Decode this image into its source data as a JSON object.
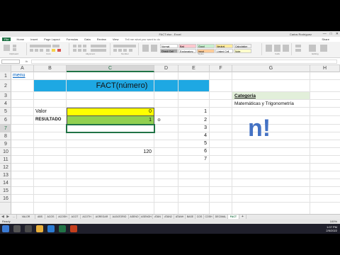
{
  "window": {
    "title": "FACT.xlsx - Excel",
    "account": "Carlos Rodríguez"
  },
  "ribbon_tabs": [
    "File",
    "Home",
    "Insert",
    "Page Layout",
    "Formulas",
    "Data",
    "Review",
    "View"
  ],
  "tell_me": "Tell me what you want to do",
  "share_label": "Share",
  "ribbon_groups": [
    "Clipboard",
    "Font",
    "Alignment",
    "Number",
    "Styles",
    "Cells",
    "Editing"
  ],
  "styles_gallery": [
    {
      "label": "Normal",
      "color": "#ffffff"
    },
    {
      "label": "Bad",
      "color": "#ffc7ce"
    },
    {
      "label": "Good",
      "color": "#c6efce"
    },
    {
      "label": "Neutral",
      "color": "#ffeb9c"
    },
    {
      "label": "Calculation",
      "color": "#f2f2f2"
    },
    {
      "label": "Check Cell",
      "color": "#a5a5a5"
    },
    {
      "label": "Explanatory...",
      "color": "#ffffff"
    },
    {
      "label": "Input",
      "color": "#ffcc99"
    },
    {
      "label": "Linked Cell",
      "color": "#ffffff"
    },
    {
      "label": "Note",
      "color": "#ffffcc"
    }
  ],
  "formula_bar": {
    "name_box": "",
    "fx": "fx",
    "formula": ""
  },
  "columns": [
    "A",
    "B",
    "C",
    "D",
    "E",
    "F",
    "G",
    "H"
  ],
  "rows": [
    "1",
    "2",
    "3",
    "4",
    "5",
    "6",
    "7",
    "8",
    "9",
    "10",
    "11",
    "12",
    "13",
    "14",
    "15",
    "16"
  ],
  "active_cell": {
    "column": "C",
    "row": "7"
  },
  "cells": {
    "menu_link": "menu",
    "header_title": "FACT(número)",
    "category_label": "Categoria",
    "category_value": "Matemáticas y Trigonometría",
    "valor_label": "Valor",
    "valor_value": "0",
    "resultado_label": "RESULTADO",
    "resultado_value": "1",
    "d6_symbol": "⊕",
    "c10_value": "120",
    "big_symbol": "n!",
    "e_column_values": [
      "1",
      "2",
      "3",
      "4",
      "5",
      "6",
      "7"
    ]
  },
  "colors": {
    "header_fill": "#1ea8e3",
    "category_fill": "#e2efda",
    "valor_fill": "#ffff00",
    "resultado_fill": "#92d050",
    "excel_green": "#217346",
    "big_symbol": "#4472c4"
  },
  "sheet_tabs": [
    "...",
    "VALOR ABSOLUTO",
    "ABS",
    "ACOS",
    "ACOSH",
    "ACOT",
    "ACOTH",
    "AGREGAR",
    "ALEATORIO",
    "ASENO",
    "ASENOH",
    "ATAN",
    "ATAN2",
    "ATANH",
    "BASE",
    "COS",
    "COSH",
    "DECIMAL",
    "FACT",
    "+"
  ],
  "active_sheet": "FACT",
  "status": {
    "ready": "Ready",
    "zoom": "100%"
  },
  "taskbar": {
    "time": "1:07 PM",
    "date": "2/5/2022"
  }
}
